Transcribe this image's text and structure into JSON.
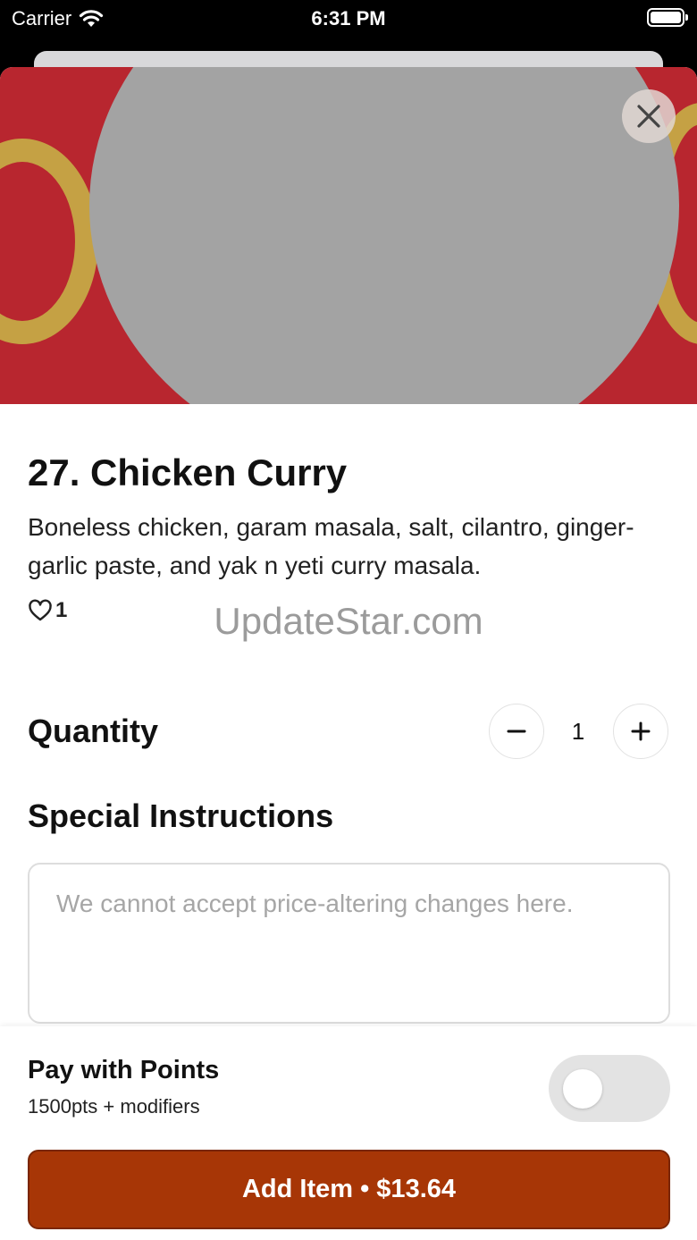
{
  "status_bar": {
    "carrier": "Carrier",
    "time": "6:31 PM"
  },
  "item": {
    "title": "27. Chicken Curry",
    "description": "Boneless chicken, garam masala, salt, cilantro, ginger-garlic paste, and yak n yeti curry masala.",
    "likes": "1"
  },
  "watermark": "UpdateStar.com",
  "quantity": {
    "label": "Quantity",
    "value": "1"
  },
  "instructions": {
    "label": "Special Instructions",
    "placeholder": "We cannot accept price-altering changes here."
  },
  "points": {
    "label": "Pay with Points",
    "sub": "1500pts + modifiers",
    "enabled": false
  },
  "add_button": {
    "label": "Add Item • $13.64"
  },
  "colors": {
    "accent": "#a73606",
    "hero_bg": "#b8262f"
  }
}
